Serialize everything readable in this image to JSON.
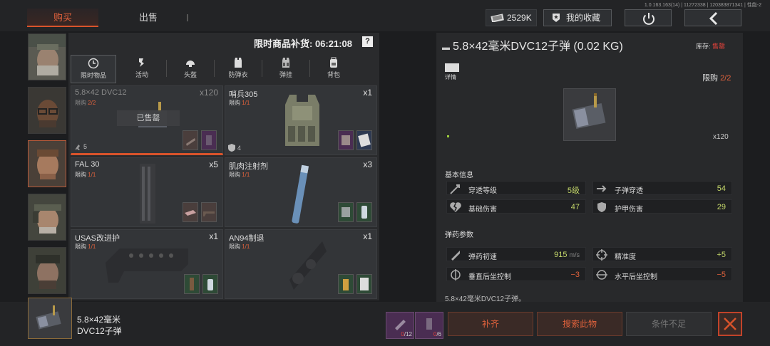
{
  "version": "1.0.163.163(14) | 11272338 | 120383871341 | 性能-2",
  "tabs": {
    "buy": "购买",
    "sell": "出售"
  },
  "currency": {
    "value": "2529K"
  },
  "favorites_label": "我的收藏",
  "restock": {
    "label": "限时商品补货: 06:21:08",
    "help": "?"
  },
  "categories": [
    {
      "label": "限时物品",
      "icon": "clock-icon"
    },
    {
      "label": "活动",
      "icon": "event-icon"
    },
    {
      "label": "头盔",
      "icon": "helmet-icon"
    },
    {
      "label": "防弹衣",
      "icon": "vest-icon"
    },
    {
      "label": "弹挂",
      "icon": "rig-icon"
    },
    {
      "label": "背包",
      "icon": "backpack-icon"
    }
  ],
  "cards": [
    {
      "name": "5.8×42 DVC12",
      "limit_prefix": "限购 ",
      "limit": "2/2",
      "qty": "x120",
      "count": "5",
      "status": "已售罄"
    },
    {
      "name": "哨兵305",
      "limit_prefix": "限购 ",
      "limit": "1/1",
      "qty": "x1",
      "count": "4"
    },
    {
      "name": "FAL 30",
      "limit_prefix": "限购 ",
      "limit": "1/1",
      "qty": "x5"
    },
    {
      "name": "肌肉注射剂",
      "limit_prefix": "限购 ",
      "limit": "1/1",
      "qty": "x3"
    },
    {
      "name": "USAS改进护",
      "limit_prefix": "限购 ",
      "limit": "1/1",
      "qty": "x1"
    },
    {
      "name": "AN94制退",
      "limit_prefix": "限购 ",
      "limit": "1/1",
      "qty": "x1"
    }
  ],
  "detail": {
    "title": "5.8×42毫米DVC12子弹 (0.02 KG)",
    "stock_prefix": "库存: ",
    "stock_value": "售罄",
    "detail_label": "详情",
    "limit_prefix": "限购 ",
    "limit_value": "2/2",
    "preview_qty": "x120",
    "basic_title": "基本信息",
    "basic_stats": [
      {
        "name": "穿透等级",
        "value": "5级"
      },
      {
        "name": "子弹穿透",
        "value": "54"
      },
      {
        "name": "基础伤害",
        "value": "47"
      },
      {
        "name": "护甲伤害",
        "value": "29"
      }
    ],
    "ammo_title": "弹药参数",
    "ammo_stats": [
      {
        "name": "弹药初速",
        "value": "915",
        "unit": "m/s"
      },
      {
        "name": "精准度",
        "value": "+5"
      },
      {
        "name": "垂直后坐控制",
        "value": "−3"
      },
      {
        "name": "水平后坐控制",
        "value": "−5"
      }
    ],
    "description": "5.8×42毫米DVC12子弹。"
  },
  "bottom": {
    "name_line1": "5.8×42毫米",
    "name_line2": "DVC12子弹",
    "slot1": {
      "have": "0",
      "need": "/12"
    },
    "slot2": {
      "have": "0",
      "need": "/6"
    },
    "fill_label": "补齐",
    "search_label": "搜索此物",
    "condition_label": "条件不足"
  },
  "colors": {
    "accent": "#e0623c",
    "positive": "#c5d86a",
    "sold_out": "#e0413a"
  }
}
